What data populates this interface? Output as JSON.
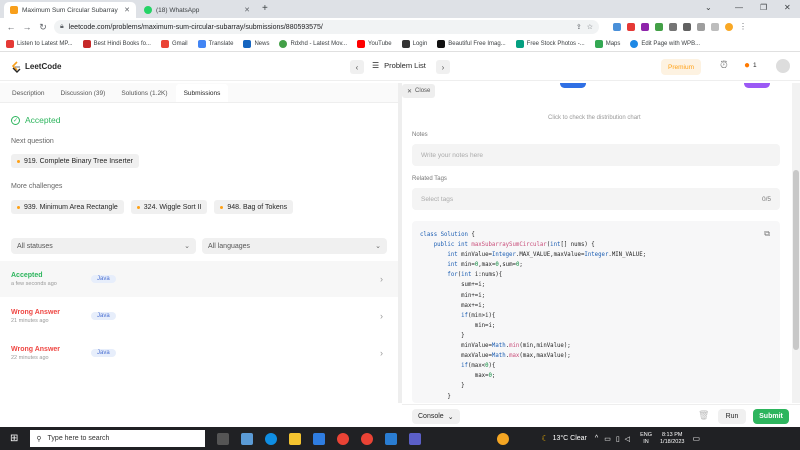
{
  "browser": {
    "tabs": [
      {
        "title": "Maximum Sum Circular Subarray",
        "active": true,
        "color": "#f89f1b"
      },
      {
        "title": "(18) WhatsApp",
        "active": false,
        "color": "#25d366"
      }
    ],
    "url": "leetcode.com/problems/maximum-sum-circular-subarray/submissions/880593575/",
    "bookmarks": [
      {
        "label": "Listen to Latest MP...",
        "color": "#e53935"
      },
      {
        "label": "Best Hindi Books fo...",
        "color": "#c62828"
      },
      {
        "label": "Gmail",
        "color": "#ea4335"
      },
      {
        "label": "Translate",
        "color": "#4285f4"
      },
      {
        "label": "News",
        "color": "#1565c0"
      },
      {
        "label": "Rdxhd - Latest Mov...",
        "color": "#43a047"
      },
      {
        "label": "YouTube",
        "color": "#ff0000"
      },
      {
        "label": "Login",
        "color": "#333333"
      },
      {
        "label": "Beautiful Free Imag...",
        "color": "#111111"
      },
      {
        "label": "Free Stock Photos -...",
        "color": "#05a081"
      },
      {
        "label": "Maps",
        "color": "#34a853"
      },
      {
        "label": "Edit Page with WPB...",
        "color": "#1e88e5"
      }
    ]
  },
  "leetcode": {
    "logo": "LeetCode",
    "problem_list": "Problem List",
    "premium": "Premium",
    "streak": "1"
  },
  "left": {
    "tabs": [
      "Description",
      "Discussion (39)",
      "Solutions (1.2K)",
      "Submissions"
    ],
    "accepted": "Accepted",
    "next_question_label": "Next question",
    "next_question": "919. Complete Binary Tree Inserter",
    "more_challenges_label": "More challenges",
    "challenges": [
      "939. Minimum Area Rectangle",
      "324. Wiggle Sort II",
      "948. Bag of Tokens"
    ],
    "filter_status": "All statuses",
    "filter_language": "All languages",
    "submissions": [
      {
        "status": "Accepted",
        "time": "a few seconds ago",
        "lang": "Java",
        "color": "#2db55d"
      },
      {
        "status": "Wrong Answer",
        "time": "21 minutes ago",
        "lang": "Java",
        "color": "#ef4743"
      },
      {
        "status": "Wrong Answer",
        "time": "22 minutes ago",
        "lang": "Java",
        "color": "#ef4743"
      }
    ]
  },
  "right": {
    "close": "Close",
    "distribution_hint": "Click to check the distribution chart",
    "notes_label": "Notes",
    "notes_placeholder": "Write your notes here",
    "tags_label": "Related Tags",
    "tags_placeholder": "Select tags",
    "tags_count": "0/5",
    "console": "Console",
    "run": "Run",
    "submit": "Submit"
  },
  "taskbar": {
    "search": "Type here to search",
    "weather": "13°C  Clear",
    "lang1": "ENG",
    "lang2": "IN",
    "time": "8:13 PM",
    "date": "1/18/2023"
  }
}
